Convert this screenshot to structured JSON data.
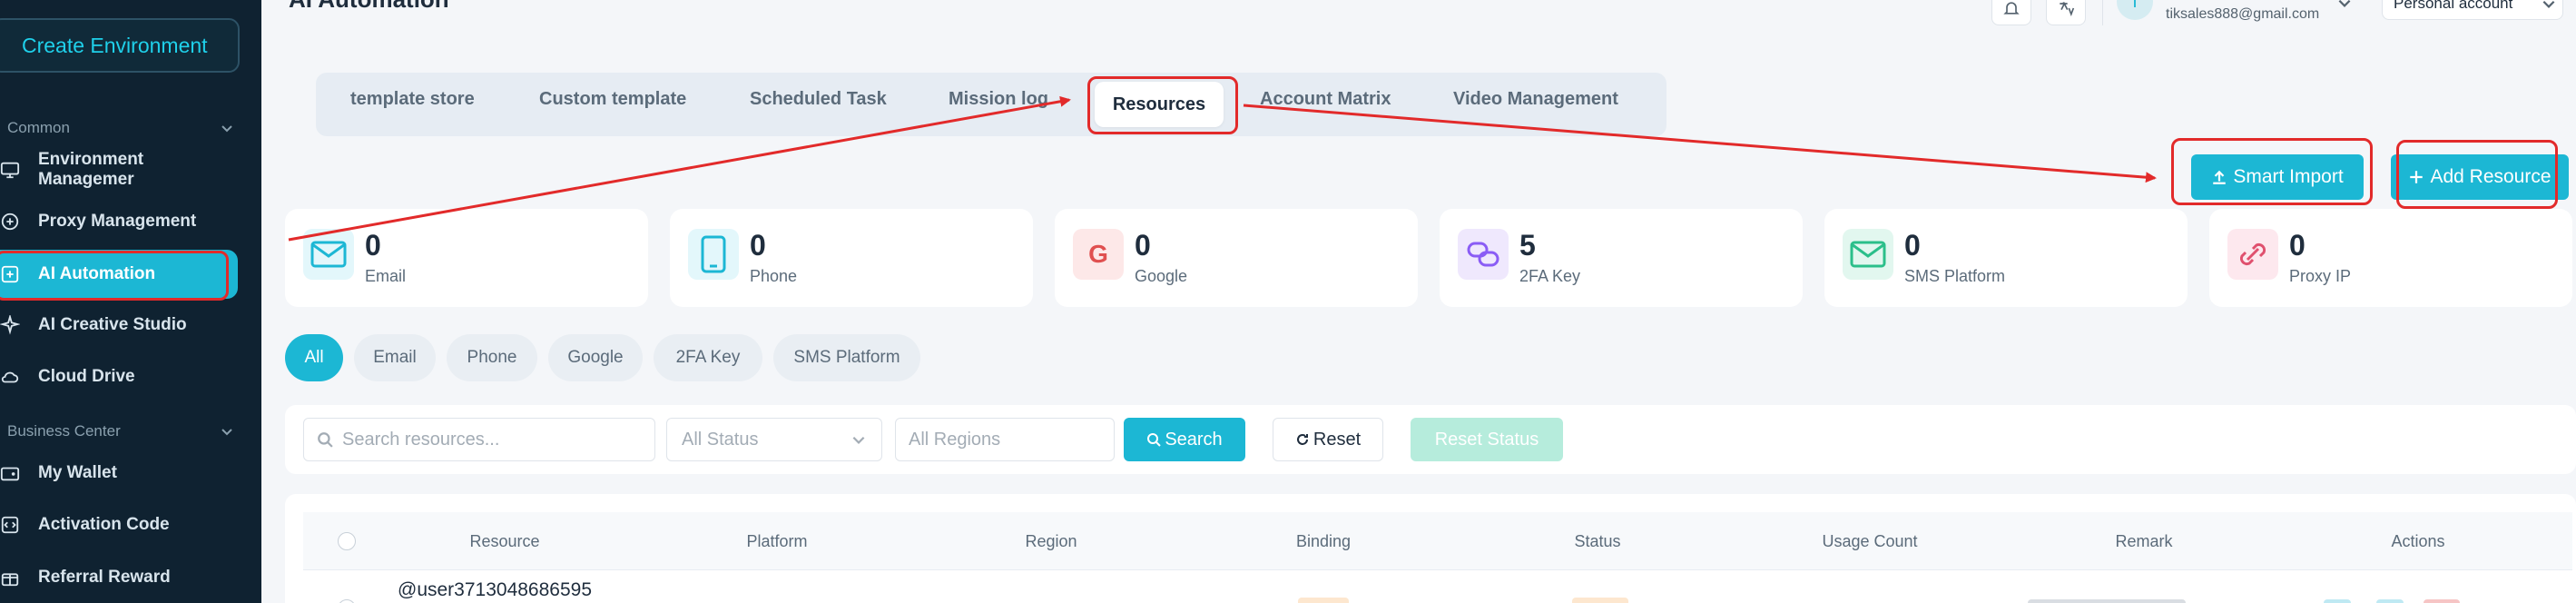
{
  "sidebar": {
    "create_button": "Create Environment",
    "sections": [
      {
        "label": "Common"
      },
      {
        "label": "Business Center"
      }
    ],
    "items": [
      {
        "label": "Environment Managemer",
        "icon": "monitor-icon"
      },
      {
        "label": "Proxy Management",
        "icon": "proxy-icon"
      },
      {
        "label": "AI Automation",
        "icon": "automation-icon",
        "active": true
      },
      {
        "label": "AI Creative Studio",
        "icon": "sparkle-icon"
      },
      {
        "label": "Cloud Drive",
        "icon": "cloud-icon"
      },
      {
        "label": "My Wallet",
        "icon": "wallet-icon"
      },
      {
        "label": "Activation Code",
        "icon": "code-icon"
      },
      {
        "label": "Referral Reward",
        "icon": "gift-icon"
      }
    ]
  },
  "header": {
    "title": "AI Automation",
    "avatar_letter": "T",
    "user_email": "tiksales888@gmail.com",
    "account_label": "Personal account",
    "icons": [
      "bell-icon",
      "language-icon"
    ]
  },
  "tabs": [
    {
      "label": "template store"
    },
    {
      "label": "Custom template"
    },
    {
      "label": "Scheduled Task"
    },
    {
      "label": "Mission log"
    },
    {
      "label": "Resources",
      "active": true
    },
    {
      "label": "Account Matrix"
    },
    {
      "label": "Video Management"
    }
  ],
  "actions": {
    "smart_import": "Smart Import",
    "add_resource": "Add Resource"
  },
  "stats": [
    {
      "value": "0",
      "label": "Email",
      "icon": "mail-icon",
      "color": "#1cb7d4"
    },
    {
      "value": "0",
      "label": "Phone",
      "icon": "phone-icon",
      "color": "#1cb7d4"
    },
    {
      "value": "0",
      "label": "Google",
      "icon": "google-icon",
      "color": "#e05050"
    },
    {
      "value": "5",
      "label": "2FA Key",
      "icon": "link-icon",
      "color": "#8a5cf5"
    },
    {
      "value": "0",
      "label": "SMS Platform",
      "icon": "sms-icon",
      "color": "#2bbf8a"
    },
    {
      "value": "0",
      "label": "Proxy IP",
      "icon": "proxy-ip-icon",
      "color": "#e0506e"
    }
  ],
  "filter_pills": [
    {
      "label": "All",
      "active": true
    },
    {
      "label": "Email"
    },
    {
      "label": "Phone"
    },
    {
      "label": "Google"
    },
    {
      "label": "2FA Key"
    },
    {
      "label": "SMS Platform"
    }
  ],
  "filters": {
    "search_placeholder": "Search resources...",
    "status_select": "All Status",
    "region_placeholder": "All Regions",
    "search_button": "Search",
    "reset_button": "Reset",
    "reset_status_button": "Reset Status"
  },
  "table": {
    "columns": [
      "Resource",
      "Platform",
      "Region",
      "Binding",
      "Status",
      "Usage Count",
      "Remark",
      "Actions"
    ],
    "rows": [
      {
        "resource": "@user3713048686595"
      }
    ]
  },
  "colors": {
    "accent": "#1cb7d4",
    "sidebar_bg": "#0f2231",
    "annotation": "#e22a2a"
  }
}
